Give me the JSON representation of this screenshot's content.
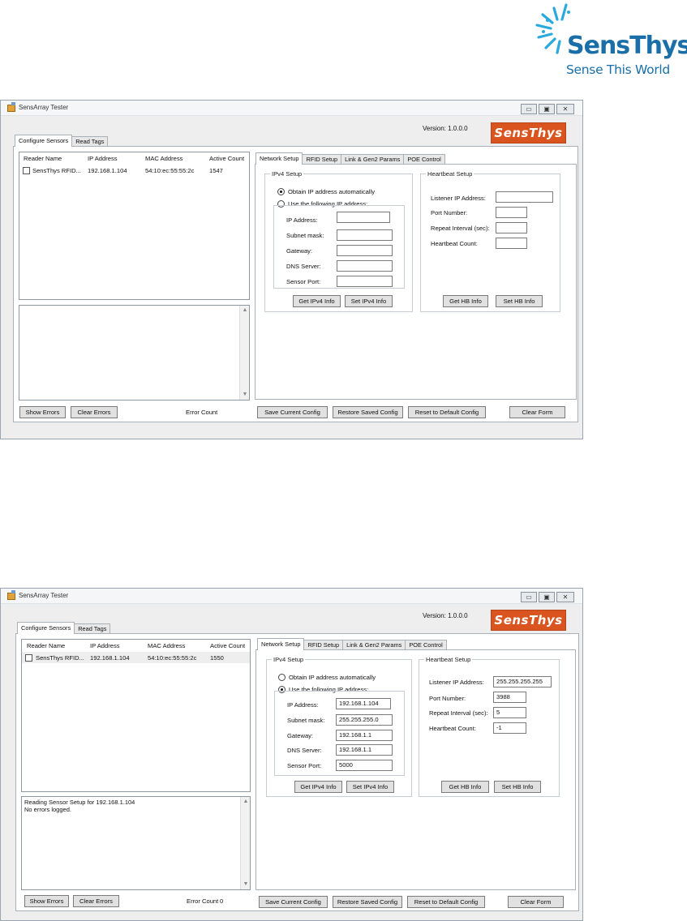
{
  "header": {
    "brand_name": "SensThys",
    "tagline": "Sense This World"
  },
  "colors": {
    "brand_blue": "#1a6fa8",
    "brand_orange": "#d9541e",
    "window_bg": "#eeeeee"
  },
  "icons": [
    "app-icon",
    "minimize-icon",
    "maximize-icon",
    "close-icon",
    "logo-starburst-icon",
    "chevron-up-icon",
    "chevron-down-icon"
  ],
  "window": {
    "title": "SensArray Tester",
    "minimize_glyph": "▭",
    "maximize_glyph": "▣",
    "close_glyph": "✕",
    "version": "Version: 1.0.0.0",
    "logo": "SensThys"
  },
  "main_tabs": [
    "Configure Sensors",
    "Read Tags"
  ],
  "config_tabs": [
    "Network Setup",
    "RFID Setup",
    "Link & Gen2 Params",
    "POE Control"
  ],
  "reader_list": {
    "columns": [
      "Reader Name",
      "IP Address",
      "MAC Address",
      "Active Count"
    ]
  },
  "ipv4": {
    "title": "IPv4 Setup",
    "radio_auto": "Obtain IP address automatically",
    "radio_manual": "Use the following IP address:",
    "labels": [
      "IP Address:",
      "Subnet mask:",
      "Gateway:",
      "DNS Server:",
      "Sensor Port:"
    ],
    "get_button": "Get IPv4 Info",
    "set_button": "Set IPv4 Info"
  },
  "heartbeat": {
    "title": "Heartbeat Setup",
    "labels": [
      "Listener IP Address:",
      "Port Number:",
      "Repeat Interval (sec):",
      "Heartbeat Count:"
    ],
    "get_button": "Get HB Info",
    "set_button": "Set HB Info"
  },
  "buttons": {
    "show_errors": "Show Errors",
    "clear_errors": "Clear Errors",
    "save_config": "Save Current Config",
    "restore_config": "Restore Saved Config",
    "reset_config": "Reset to Default Config",
    "clear_form": "Clear Form"
  },
  "error_count_label": "Error Count",
  "screenshot1": {
    "row": {
      "name": "SensThys RFID...",
      "ip": "192.168.1.104",
      "mac": "54:10:ec:55:55:2c",
      "count": "1547"
    },
    "ipv4_mode": "auto",
    "ipv4_values": [
      "",
      "",
      "",
      "",
      ""
    ],
    "hb_values": [
      "",
      "",
      "",
      ""
    ],
    "log_lines": [
      "",
      ""
    ],
    "error_count": ""
  },
  "screenshot2": {
    "row": {
      "name": "SensThys RFID...",
      "ip": "192.168.1.104",
      "mac": "54:10:ec:55:55:2c",
      "count": "1550"
    },
    "ipv4_mode": "manual",
    "ipv4_values": [
      "192.168.1.104",
      "255.255.255.0",
      "192.168.1.1",
      "192.168.1.1",
      "5000"
    ],
    "hb_values": [
      "255.255.255.255",
      "3988",
      "5",
      "-1"
    ],
    "log_lines": [
      "Reading Sensor Setup for 192.168.1.104",
      "No errors logged."
    ],
    "error_count": "0"
  }
}
